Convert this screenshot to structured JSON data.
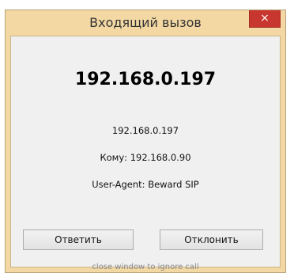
{
  "window": {
    "title": "Входящий вызов",
    "close_glyph": "×"
  },
  "call": {
    "caller_large": "192.168.0.197",
    "caller_small": "192.168.0.197",
    "to_line": "Кому: 192.168.0.90",
    "user_agent_line": "User-Agent: Beward SIP"
  },
  "buttons": {
    "answer_label": "Ответить",
    "decline_label": "Отклонить"
  },
  "hint": "close window to ignore call",
  "colors": {
    "frame": "#f3d8a4",
    "close_button": "#c7372f",
    "client_bg": "#f0f0f0"
  }
}
